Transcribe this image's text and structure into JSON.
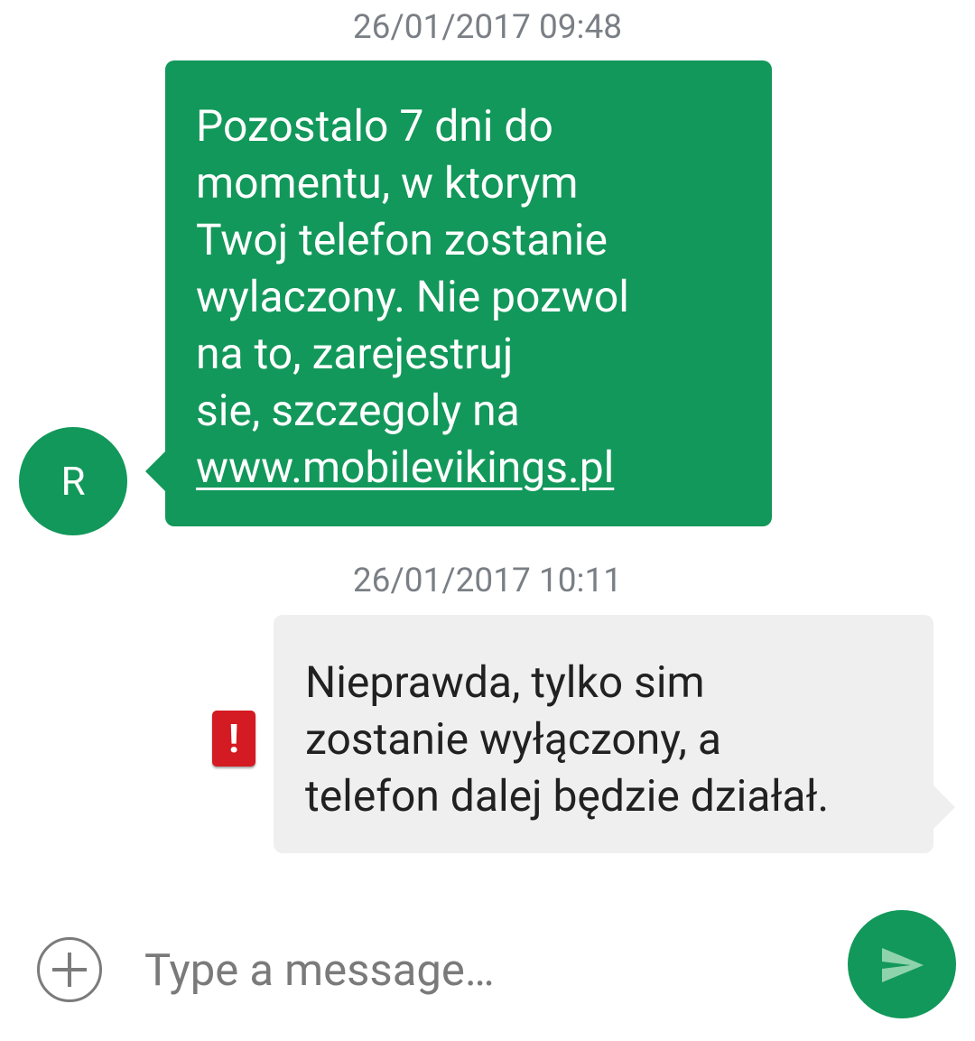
{
  "colors": {
    "accent": "#12985a",
    "outgoing_bubble": "#efefef",
    "error": "#d41a22"
  },
  "conversation": {
    "incoming_message": {
      "timestamp": "26/01/2017 09:48",
      "avatar_letter": "R",
      "lines": [
        "Pozostalo 7 dni do",
        "momentu, w ktorym",
        "Twoj telefon zostanie",
        "wylaczony. Nie pozwol",
        "na to, zarejestruj",
        "sie, szczegoly na"
      ],
      "link": "www.mobilevikings.pl"
    },
    "outgoing_message": {
      "timestamp": "26/01/2017 10:11",
      "lines": [
        "Nieprawda, tylko sim",
        "zostanie wyłączony, a",
        "telefon dalej będzie działał."
      ],
      "status_icon": "error-icon",
      "status_symbol": "!"
    }
  },
  "composer": {
    "add_icon": "plus-circle-icon",
    "placeholder": "Type a message…",
    "value": "",
    "send_icon": "send-icon"
  }
}
